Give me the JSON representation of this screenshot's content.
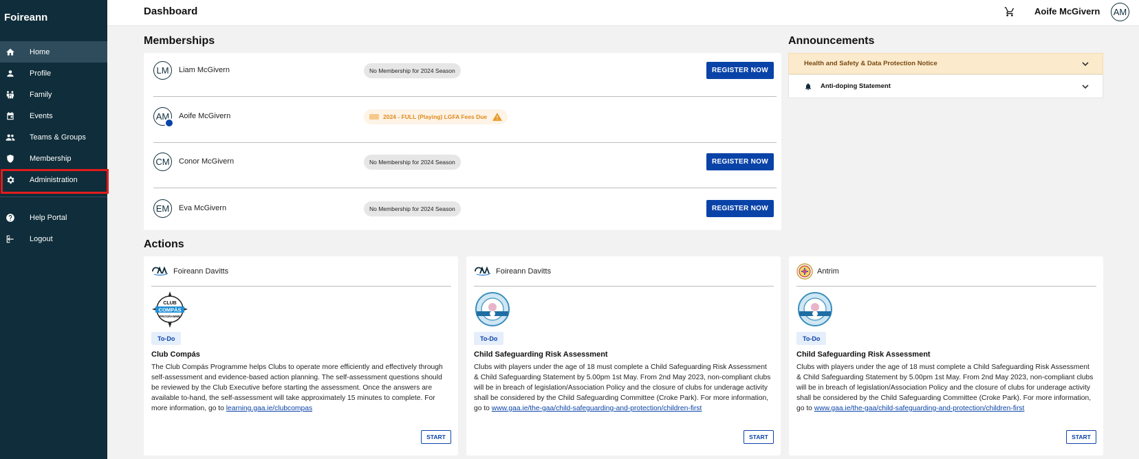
{
  "sidebar": {
    "brand": "Foireann",
    "items": [
      {
        "label": "Home",
        "icon": "home-icon"
      },
      {
        "label": "Profile",
        "icon": "person-icon"
      },
      {
        "label": "Family",
        "icon": "family-icon"
      },
      {
        "label": "Events",
        "icon": "calendar-icon"
      },
      {
        "label": "Teams & Groups",
        "icon": "group-icon"
      },
      {
        "label": "Membership",
        "icon": "shield-icon"
      },
      {
        "label": "Administration",
        "icon": "gear-icon"
      },
      {
        "label": "Help Portal",
        "icon": "help-icon"
      },
      {
        "label": "Logout",
        "icon": "logout-icon"
      }
    ]
  },
  "topbar": {
    "title": "Dashboard",
    "user_name": "Aoife McGivern",
    "user_initials": "AM"
  },
  "memberships": {
    "title": "Memberships",
    "rows": [
      {
        "initials": "LM",
        "name": "Liam McGivern",
        "status": "No Membership for 2024 Season",
        "action": "REGISTER NOW"
      },
      {
        "initials": "AM",
        "name": "Aoife McGivern",
        "status": "2024 - FULL (Playing) LGFA Fees Due"
      },
      {
        "initials": "CM",
        "name": "Conor McGivern",
        "status": "No Membership for 2024 Season",
        "action": "REGISTER NOW"
      },
      {
        "initials": "EM",
        "name": "Eva McGivern",
        "status": "No Membership for 2024 Season",
        "action": "REGISTER NOW"
      }
    ]
  },
  "announcements": {
    "title": "Announcements",
    "items": [
      {
        "label": "Health and Safety & Data Protection Notice"
      },
      {
        "label": "Anti-doping Statement"
      }
    ]
  },
  "actions": {
    "title": "Actions",
    "cards": [
      {
        "org": "Foireann Davitts",
        "status": "To-Do",
        "title": "Club Compás",
        "desc": "The Club Compás Programme helps Clubs to operate more efficiently and effectively through self-assessment and evidence-based action planning. The self-assessment questions should be reviewed by the Club Executive before starting the assessment. Once the answers are available to-hand, the self-assessment will take approximately 15 minutes to complete. For more information, go to ",
        "link": "learning.gaa.ie/clubcompas",
        "button": "START"
      },
      {
        "org": "Foireann Davitts",
        "status": "To-Do",
        "title": "Child Safeguarding Risk Assessment",
        "desc": "Clubs with players under the age of 18 must complete a Child Safeguarding Risk Assessment & Child Safeguarding Statement by 5.00pm 1st May. From 2nd May 2023, non-compliant clubs will be in breach of legislation/Association Policy and the closure of clubs for underage activity shall be considered by the Child Safeguarding Committee (Croke Park). For more information, go to ",
        "link": "www.gaa.ie/the-gaa/child-safeguarding-and-protection/children-first",
        "button": "START"
      },
      {
        "org": "Antrim",
        "status": "To-Do",
        "title": "Child Safeguarding Risk Assessment",
        "desc": "Clubs with players under the age of 18 must complete a Child Safeguarding Risk Assessment & Child Safeguarding Statement by 5.00pm 1st May. From 2nd May 2023, non-compliant clubs will be in breach of legislation/Association Policy and the closure of clubs for underage activity shall be considered by the Child Safeguarding Committee (Croke Park). For more information, go to ",
        "link": "www.gaa.ie/the-gaa/child-safeguarding-and-protection/children-first",
        "button": "START"
      }
    ]
  },
  "colors": {
    "sidebar_bg": "#0f2d3a",
    "primary": "#0a43a8",
    "warning": "#e08a1e",
    "highlight": "#e31c1c"
  }
}
